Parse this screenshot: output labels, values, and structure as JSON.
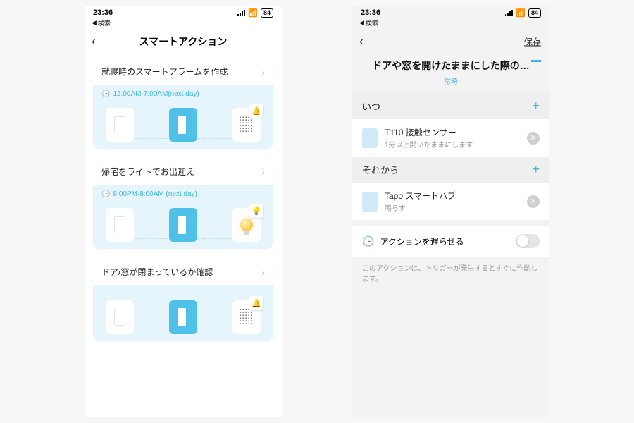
{
  "status": {
    "time": "23:36",
    "battery": "84",
    "breadcrumb_label": "検索"
  },
  "left": {
    "title": "スマートアクション",
    "cards": [
      {
        "title": "就寝時のスマートアラームを作成",
        "time": "12:00AM-7:00AM(next day)"
      },
      {
        "title": "帰宅をライトでお出迎え",
        "time": "8:00PM-8:00AM (next day)"
      },
      {
        "title": "ドア/窓が閉まっているか確認",
        "time": ""
      }
    ]
  },
  "right": {
    "save": "保存",
    "title": "ドアや窓を開けたままにした際の…",
    "subtitle": "常時",
    "when_label": "いつ",
    "then_label": "それから",
    "trigger": {
      "name": "T110 接触センサー",
      "detail": "1分以上開いたままにします"
    },
    "action": {
      "name": "Tapo スマートハブ",
      "detail": "鳴らす"
    },
    "delay_label": "アクションを遅らせる",
    "note": "このアクションは、トリガーが発生するとすぐに作動します。"
  }
}
